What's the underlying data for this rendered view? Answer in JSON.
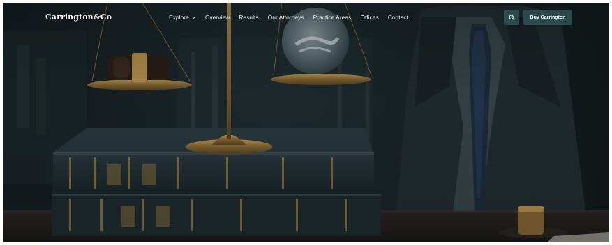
{
  "header": {
    "logo": "Carrington&Co",
    "nav": [
      {
        "label": "Explore",
        "has_dropdown": true
      },
      {
        "label": "Overview"
      },
      {
        "label": "Results"
      },
      {
        "label": "Our Attorneys"
      },
      {
        "label": "Practice Areas"
      },
      {
        "label": "Offices"
      },
      {
        "label": "Contact"
      }
    ],
    "search_icon": "search-icon",
    "cta_label": "Buy Carrington"
  },
  "colors": {
    "accent": "#2c4a4d",
    "nav_text": "#e9eef0",
    "hero_base": "#1a2124"
  },
  "hero": {
    "image_subject": "scales of justice, gavel, law books, attorney in suit"
  }
}
